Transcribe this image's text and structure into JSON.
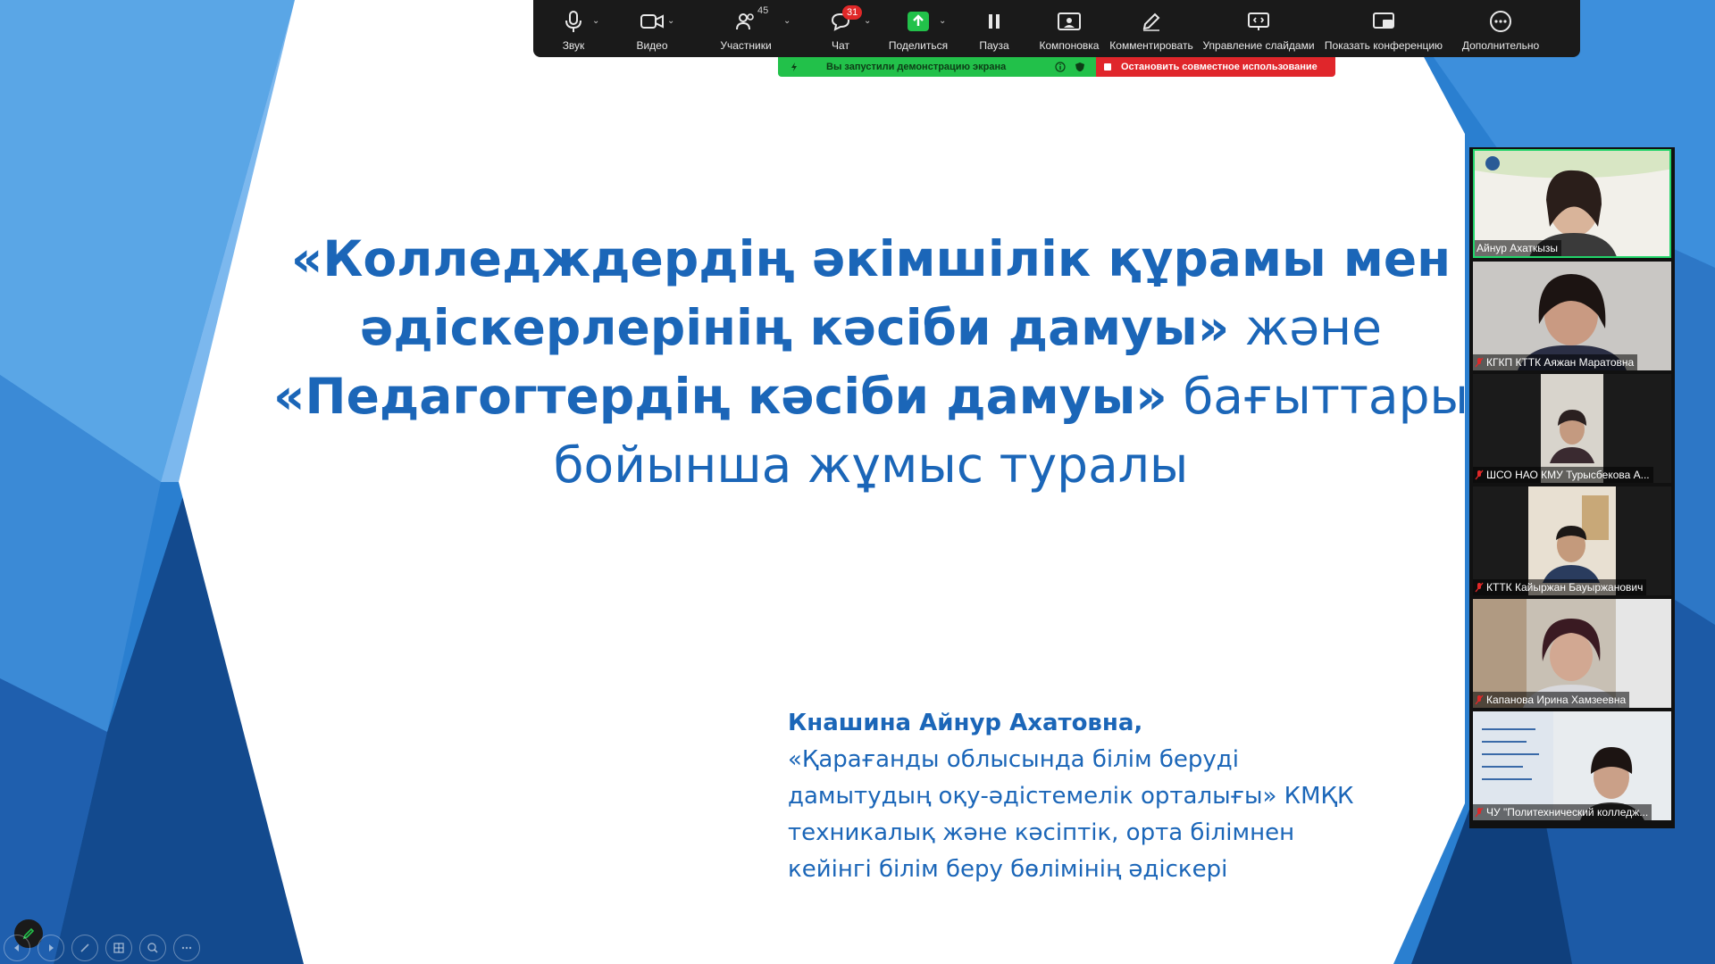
{
  "toolbar": {
    "items": [
      {
        "label": "Звук",
        "icon": "microphone-icon"
      },
      {
        "label": "Видео",
        "icon": "video-camera-icon"
      },
      {
        "label": "Участники",
        "icon": "participants-icon",
        "count": "45"
      },
      {
        "label": "Чат",
        "icon": "chat-icon",
        "badge": "31"
      },
      {
        "label": "Поделиться",
        "icon": "share-screen-icon"
      },
      {
        "label": "Пауза",
        "icon": "pause-icon"
      },
      {
        "label": "Компоновка",
        "icon": "layout-icon"
      },
      {
        "label": "Комментировать",
        "icon": "annotate-pencil-icon"
      },
      {
        "label": "Управление слайдами",
        "icon": "slide-control-icon"
      },
      {
        "label": "Показать конференцию",
        "icon": "show-meeting-icon"
      },
      {
        "label": "Дополнительно",
        "icon": "more-icon"
      }
    ]
  },
  "sharebar": {
    "status": "Вы запустили демонстрацию экрана",
    "stop": "Остановить совместное использование"
  },
  "slide": {
    "title_1": "«Колледждердің әкімшілік құрамы мен",
    "title_2a": "әдіскерлерінің кәсіби дамуы»",
    "title_2b": " және",
    "title_3a": "«Педагогтердің кәсіби дамуы»",
    "title_3b": " бағыттары",
    "title_4": "бойынша жұмыс туралы",
    "author_name": "Кнашина Айнур Ахатовна,",
    "author_line_1": "«Қарағанды облысында білім беруді",
    "author_line_2": "дамытудың  оқу-әдістемелік орталығы» КМҚК",
    "author_line_3": "техникалық және кәсіптік, орта білімнен",
    "author_line_4": "кейінгі білім беру бөлімінің әдіскері"
  },
  "participants": [
    {
      "name": "Айнур Ахаткызы",
      "muted": false
    },
    {
      "name": "КГКП КТТК Аяжан Маратовна",
      "muted": true
    },
    {
      "name": "ШСО НАО КМУ Турысбекова А...",
      "muted": true
    },
    {
      "name": "КТТК Кайыржан Бауыржанович",
      "muted": true
    },
    {
      "name": "Капанова Ирина Хамзеевна",
      "muted": true
    },
    {
      "name": "ЧУ \"Политехнический  колледж...",
      "muted": true
    }
  ],
  "colors": {
    "slide_text": "#1b66b8",
    "share_green": "#22c14a",
    "share_red": "#e0262b",
    "toolbar_bg": "#1a1a1a"
  }
}
